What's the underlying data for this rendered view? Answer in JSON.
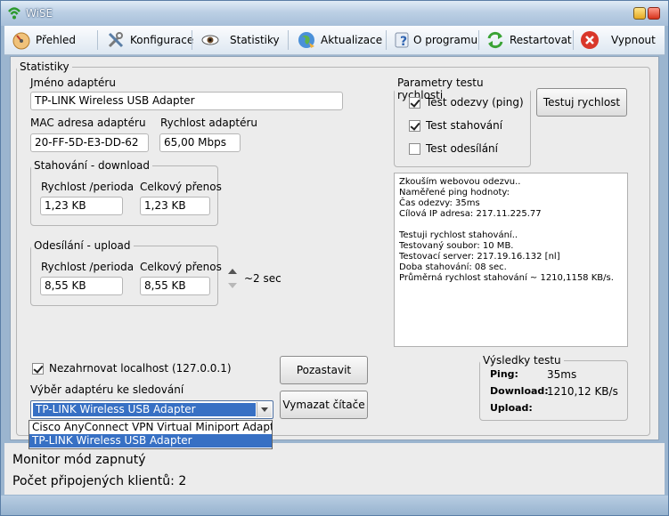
{
  "window": {
    "title": "WiSE"
  },
  "toolbar": {
    "overview": "Přehled",
    "config": "Konfigurace",
    "stats": "Statistiky",
    "update": "Aktualizace",
    "about": "O programu",
    "restart": "Restartovat",
    "quit": "Vypnout"
  },
  "stats": {
    "legend": "Statistiky",
    "adapter_name_label": "Jméno adaptéru",
    "adapter_name": "TP-LINK Wireless USB Adapter",
    "mac_label": "MAC adresa adaptéru",
    "mac": "20-FF-5D-E3-DD-62",
    "speed_label": "Rychlost adaptéru",
    "speed": "65,00 Mbps",
    "download": {
      "legend": "Stahování - download",
      "rate_label": "Rychlost /perioda",
      "total_label": "Celkový přenos",
      "rate": "1,23 KB",
      "total": "1,23 KB"
    },
    "upload": {
      "legend": "Odesílání - upload",
      "rate_label": "Rychlost /perioda",
      "total_label": "Celkový přenos",
      "rate": "8,55 KB",
      "total": "8,55 KB"
    },
    "period": "~2 sec"
  },
  "speedtest": {
    "legend": "Parametry testu rychlosti",
    "opt_ping": "Test odezvy (ping)",
    "opt_download": "Test stahování",
    "opt_upload": "Test odesílání",
    "ping_checked": true,
    "download_checked": true,
    "upload_checked": false,
    "button": "Testuj rychlost"
  },
  "log": [
    "Zkouším webovou odezvu..",
    "Naměřené ping hodnoty:",
    "Čas odezvy: 35ms",
    "Cílová IP adresa: 217.11.225.77",
    "",
    "Testuji rychlost stahování..",
    "Testovaný soubor: 10 MB.",
    "Testovací server: 217.19.16.132 [nl]",
    "Doba stahování: 08 sec.",
    "Průměrná rychlost stahování ~ 1210,1158 KB/s."
  ],
  "results": {
    "legend": "Výsledky testu",
    "ping_label": "Ping:",
    "ping": "35ms",
    "download_label": "Download:",
    "download": "1210,12 KB/s",
    "upload_label": "Upload:",
    "upload": ""
  },
  "monitor": {
    "ignore_localhost": "Nezahrnovat localhost (127.0.0.1)",
    "ignore_checked": true,
    "select_label": "Výběr adaptéru ke sledování",
    "selected": "TP-LINK Wireless USB Adapter",
    "options": [
      "Cisco AnyConnect VPN Virtual Miniport Adapter fo",
      "TP-LINK Wireless USB Adapter"
    ],
    "pause": "Pozastavit",
    "clear": "Vymazat čítače"
  },
  "status": {
    "line1": "Monitor mód zapnutý",
    "line2": "Počet připojených klientů: 2"
  }
}
